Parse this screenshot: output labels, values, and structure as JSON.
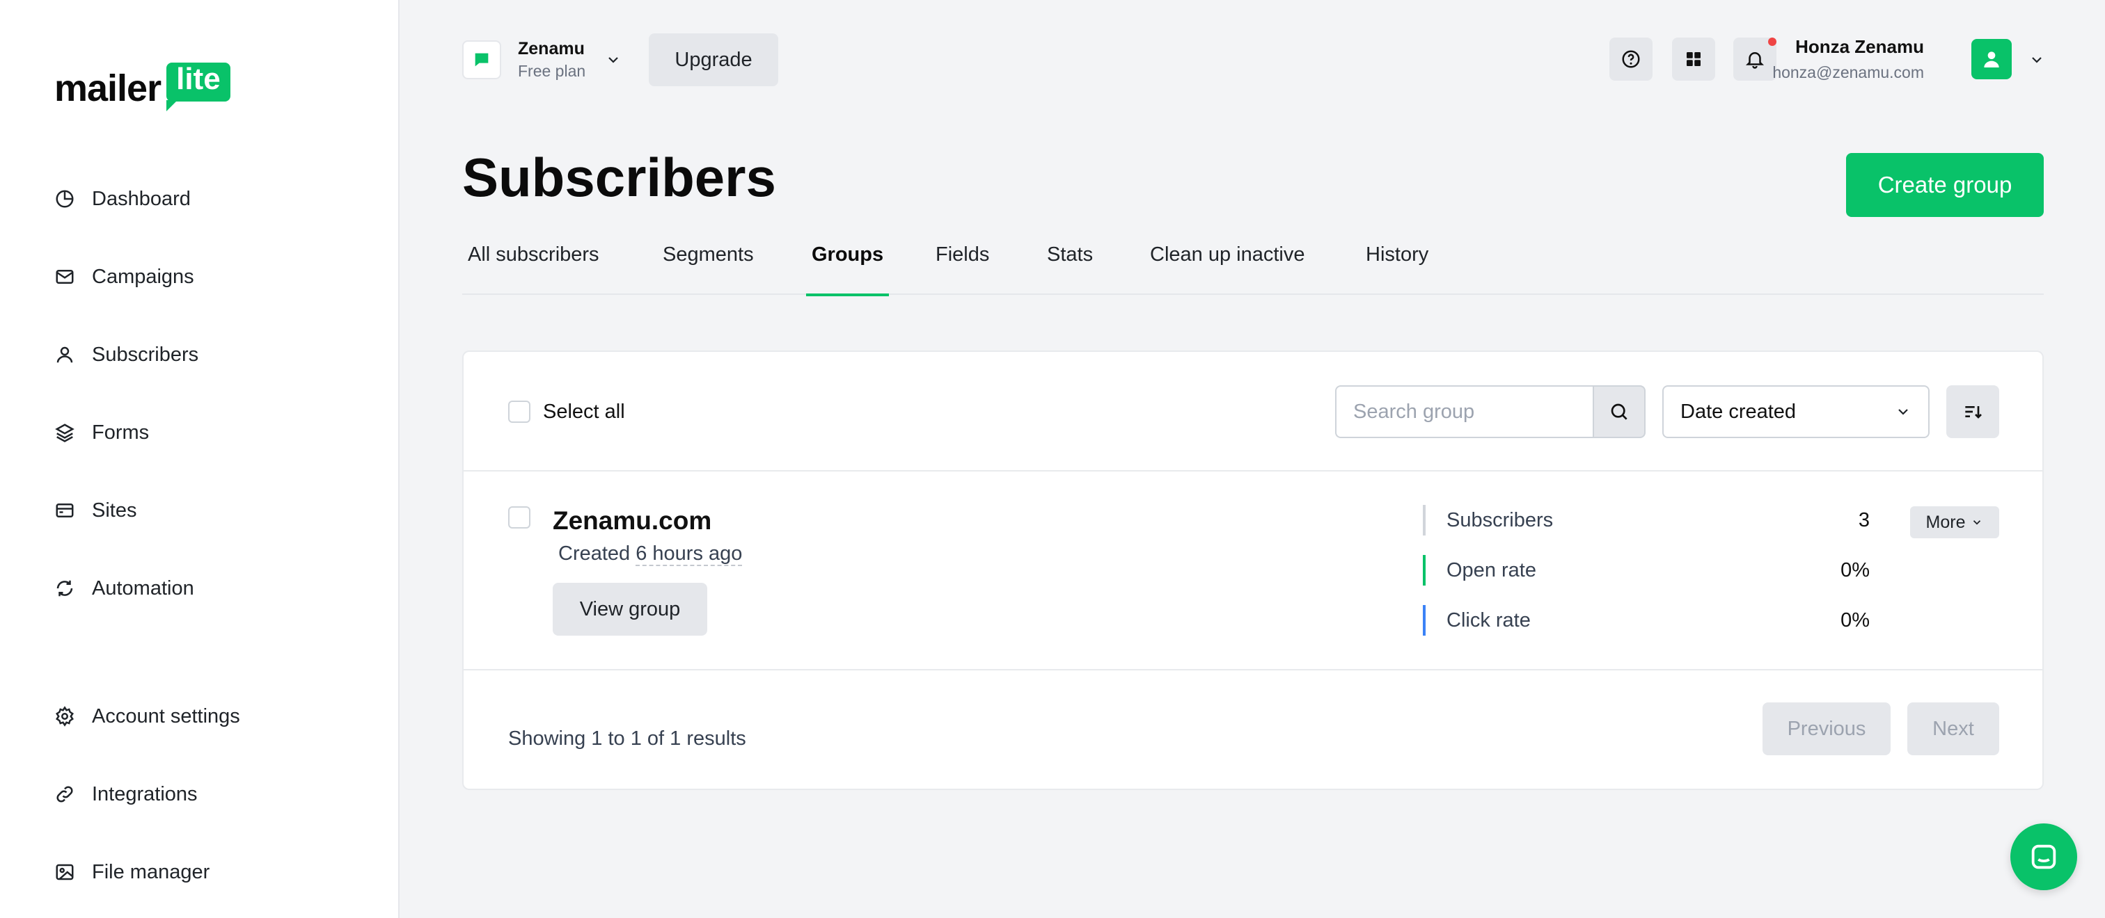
{
  "logo": {
    "word": "mailer",
    "badge": "lite"
  },
  "sidebar": {
    "items": [
      {
        "label": "Dashboard",
        "icon": "clock-pie-icon"
      },
      {
        "label": "Campaigns",
        "icon": "envelope-icon"
      },
      {
        "label": "Subscribers",
        "icon": "user-icon"
      },
      {
        "label": "Forms",
        "icon": "layers-icon"
      },
      {
        "label": "Sites",
        "icon": "browser-window-icon"
      },
      {
        "label": "Automation",
        "icon": "refresh-icon"
      },
      {
        "label": "Account settings",
        "icon": "gear-icon"
      },
      {
        "label": "Integrations",
        "icon": "link-icon"
      },
      {
        "label": "File manager",
        "icon": "image-icon"
      }
    ]
  },
  "header": {
    "account_name": "Zenamu",
    "account_plan": "Free plan",
    "upgrade_label": "Upgrade",
    "user_name": "Honza Zenamu",
    "user_email": "honza@zenamu.com"
  },
  "page": {
    "title": "Subscribers",
    "create_label": "Create group",
    "tabs": [
      "All subscribers",
      "Segments",
      "Groups",
      "Fields",
      "Stats",
      "Clean up inactive",
      "History"
    ],
    "active_tab": "Groups"
  },
  "toolbar": {
    "select_all_label": "Select all",
    "search_placeholder": "Search group",
    "sort_value": "Date created"
  },
  "groups": [
    {
      "name": "Zenamu.com",
      "created_prefix": "Created",
      "created_ago": "6 hours ago",
      "view_label": "View group",
      "more_label": "More",
      "stats": [
        {
          "label": "Subscribers",
          "value": "3"
        },
        {
          "label": "Open rate",
          "value": "0%"
        },
        {
          "label": "Click rate",
          "value": "0%"
        }
      ]
    }
  ],
  "pagination": {
    "summary": "Showing 1 to 1 of 1 results",
    "previous_label": "Previous",
    "next_label": "Next"
  },
  "colors": {
    "brand_green": "#09c269",
    "click_rate_blue": "#3b82f6",
    "notification_red": "#ef4444"
  }
}
